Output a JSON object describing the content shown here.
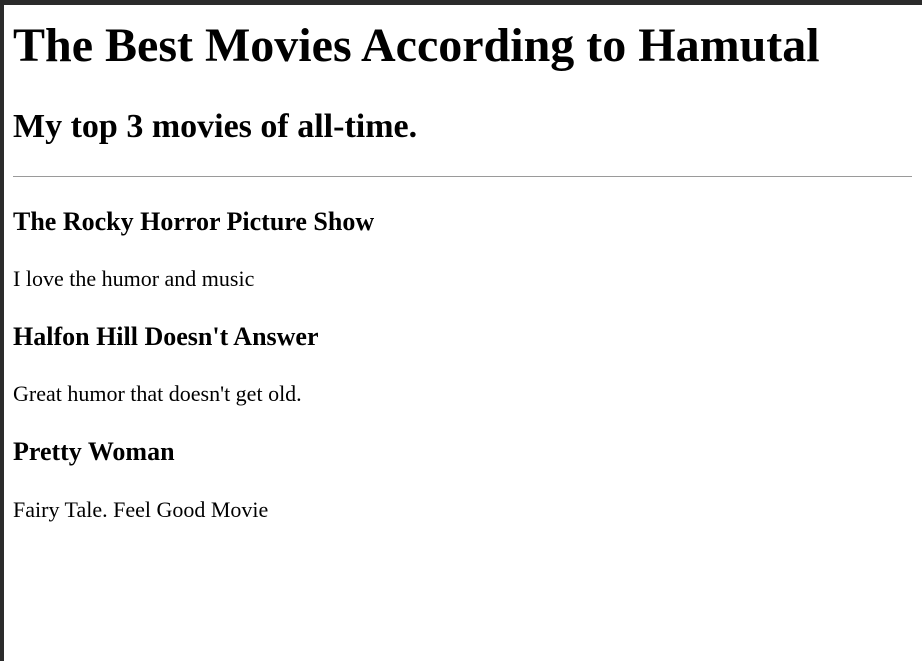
{
  "page": {
    "title": "The Best Movies According to Hamutal",
    "subtitle": "My top 3 movies of all-time."
  },
  "movies": [
    {
      "title": "The Rocky Horror Picture Show",
      "description": "I love the humor and music"
    },
    {
      "title": "Halfon Hill Doesn't Answer",
      "description": "Great humor that doesn't get old."
    },
    {
      "title": "Pretty Woman",
      "description": "Fairy Tale. Feel Good Movie"
    }
  ],
  "colors": {
    "background": "#ffffff",
    "text": "#000000",
    "frame": "#2b2b2b",
    "divider": "#9a9a9a"
  }
}
